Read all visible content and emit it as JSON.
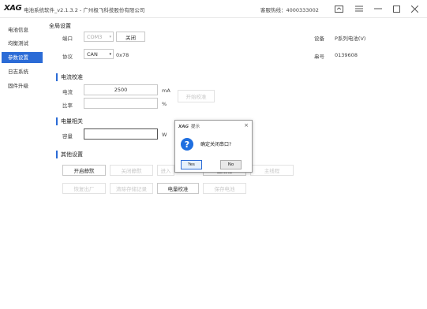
{
  "window": {
    "logo": "XAG",
    "title": "电池系统软件_v2.1.3.2 - 广州极飞科技股份有限公司",
    "hotline": "客服热线：4000333002",
    "controls": [
      "□",
      "≡",
      "—",
      "☐",
      "✕"
    ]
  },
  "sidebar": {
    "items": [
      {
        "label": "电池信息",
        "active": false
      },
      {
        "label": "均衡测试",
        "active": false
      },
      {
        "label": "参数设置",
        "active": true
      },
      {
        "label": "日志系统",
        "active": false
      },
      {
        "label": "固件升级",
        "active": false
      }
    ]
  },
  "global": {
    "title": "全局设置",
    "port_label": "端口",
    "port_value": "COM3",
    "open_button": "关闭",
    "device_label": "设备",
    "device_value": "P系列电池(V)",
    "protocol_label": "协议",
    "protocol_value": "CAN",
    "protocol_extra": "0x78",
    "serial_label": "串号",
    "serial_value": "0139608"
  },
  "current": {
    "title": "电流校准",
    "current_label": "电流",
    "current_value": "2500",
    "current_unit": "mA",
    "ratio_label": "比率",
    "ratio_value": "",
    "ratio_unit": "%",
    "calibrate_button": "开始校准"
  },
  "power": {
    "title": "电量相关",
    "label": "容量",
    "value": "",
    "unit": "W"
  },
  "other": {
    "title": "其他设置",
    "row1": [
      "开启静默",
      "关闭静默",
      "进入",
      "主线程",
      "主线程"
    ],
    "row2": [
      "恢复出厂",
      "清除存储记录",
      "电量校准",
      "保存电池"
    ]
  },
  "dialog": {
    "title": "提示",
    "close": "×",
    "icon": "?",
    "message": "确定关闭串口?",
    "yes": "Yes",
    "no": "No"
  }
}
